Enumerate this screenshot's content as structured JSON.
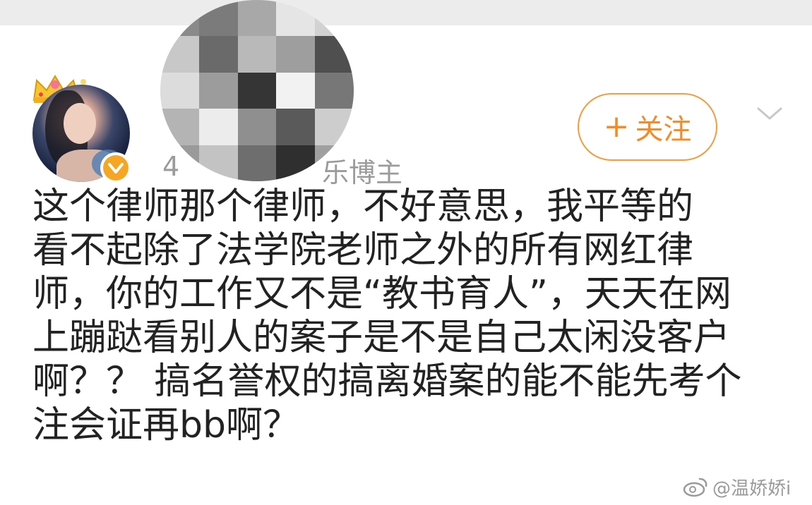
{
  "post": {
    "follow_label": "关注",
    "follow_plus": "+",
    "sub_prefix": "4",
    "sub_suffix": "乐博主",
    "content_lines": [
      "这个律师那个律师，不好意思，我平等的",
      "看不起除了法学院老师之外的所有网红律",
      "师，你的工作又不是“教书育人”，天天在网",
      "上蹦跶看别人的案子是不是自己太闲没客户",
      "啊？？ 搞名誉权的搞离婚案的能不能先考个",
      "注会证再bb啊？"
    ]
  },
  "watermark": {
    "text": "@温娇娇i"
  },
  "colors": {
    "accent": "#f28c28",
    "verified": "#f5a623",
    "text": "#222222",
    "muted": "#9b9b9b"
  },
  "icons": [
    "crown-icon",
    "verified-icon",
    "chevron-down-icon",
    "weibo-logo-icon"
  ]
}
